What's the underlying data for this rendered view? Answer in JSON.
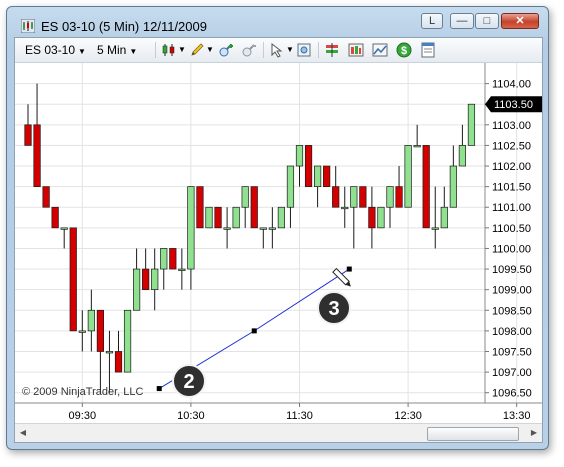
{
  "window": {
    "title": "ES 03-10 (5 Min)  12/11/2009",
    "buttons": {
      "link": "L",
      "minimize": "—",
      "maximize": "□",
      "close": "✕"
    }
  },
  "toolbar": {
    "instrument": "ES 03-10",
    "interval": "5 Min"
  },
  "chart": {
    "copyright": "© 2009 NinjaTrader, LLC",
    "price_axis": [
      "1104.00",
      "1103.50",
      "1103.00",
      "1102.50",
      "1102.00",
      "1101.50",
      "1101.00",
      "1100.50",
      "1100.00",
      "1099.50",
      "1099.00",
      "1098.50",
      "1098.00",
      "1097.50",
      "1097.00",
      "1096.50"
    ],
    "time_axis": [
      "09:30",
      "10:30",
      "11:30",
      "12:30",
      "13:30"
    ],
    "last_price": "1103.50",
    "markers": [
      "2",
      "3"
    ],
    "colors": {
      "up": "#8fe08f",
      "down": "#d40000",
      "line": "#1a2fd6",
      "grid": "#e3e3e3"
    }
  },
  "chart_data": {
    "type": "candlestick",
    "x_unit": "5-minute bars",
    "ylim": [
      1096.25,
      1104.5
    ],
    "candles": [
      [
        1103.0,
        1103.5,
        1102.5,
        1102.5
      ],
      [
        1103.0,
        1104.0,
        1101.5,
        1101.5
      ],
      [
        1101.5,
        1101.5,
        1101.0,
        1101.0
      ],
      [
        1101.0,
        1101.0,
        1100.5,
        1100.5
      ],
      [
        1100.5,
        1100.5,
        1100.0,
        1100.5
      ],
      [
        1100.5,
        1100.5,
        1098.0,
        1098.0
      ],
      [
        1098.0,
        1098.5,
        1097.5,
        1098.0
      ],
      [
        1098.0,
        1099.0,
        1097.5,
        1098.5
      ],
      [
        1098.5,
        1098.5,
        1096.5,
        1097.5
      ],
      [
        1097.5,
        1098.0,
        1096.5,
        1097.5
      ],
      [
        1097.5,
        1098.0,
        1097.0,
        1097.0
      ],
      [
        1097.0,
        1098.5,
        1097.0,
        1098.5
      ],
      [
        1098.5,
        1100.0,
        1098.5,
        1099.5
      ],
      [
        1099.5,
        1100.0,
        1099.0,
        1099.0
      ],
      [
        1099.0,
        1100.0,
        1098.5,
        1099.5
      ],
      [
        1099.5,
        1100.0,
        1099.0,
        1100.0
      ],
      [
        1100.0,
        1100.0,
        1099.5,
        1099.5
      ],
      [
        1099.5,
        1100.0,
        1099.0,
        1099.5
      ],
      [
        1099.5,
        1101.5,
        1099.0,
        1101.5
      ],
      [
        1101.5,
        1101.5,
        1100.5,
        1100.5
      ],
      [
        1100.5,
        1101.0,
        1100.5,
        1101.0
      ],
      [
        1101.0,
        1101.0,
        1100.5,
        1100.5
      ],
      [
        1100.5,
        1101.0,
        1100.0,
        1100.5
      ],
      [
        1100.5,
        1101.0,
        1100.5,
        1101.0
      ],
      [
        1101.0,
        1101.5,
        1100.5,
        1101.5
      ],
      [
        1101.5,
        1101.5,
        1100.5,
        1100.5
      ],
      [
        1100.5,
        1100.5,
        1100.0,
        1100.5
      ],
      [
        1100.5,
        1101.0,
        1100.0,
        1100.5
      ],
      [
        1100.5,
        1101.0,
        1100.5,
        1101.0
      ],
      [
        1101.0,
        1102.0,
        1100.5,
        1102.0
      ],
      [
        1102.0,
        1102.5,
        1101.5,
        1102.5
      ],
      [
        1102.5,
        1102.5,
        1101.5,
        1101.5
      ],
      [
        1101.5,
        1102.0,
        1101.0,
        1102.0
      ],
      [
        1102.0,
        1102.0,
        1101.5,
        1101.5
      ],
      [
        1101.5,
        1102.0,
        1101.0,
        1101.0
      ],
      [
        1101.0,
        1101.5,
        1100.5,
        1101.0
      ],
      [
        1101.0,
        1101.5,
        1100.0,
        1101.5
      ],
      [
        1101.5,
        1101.5,
        1101.0,
        1101.0
      ],
      [
        1101.0,
        1101.5,
        1100.0,
        1100.5
      ],
      [
        1100.5,
        1101.0,
        1100.5,
        1101.0
      ],
      [
        1101.0,
        1101.5,
        1100.5,
        1101.5
      ],
      [
        1101.5,
        1102.0,
        1101.0,
        1101.0
      ],
      [
        1101.0,
        1102.5,
        1101.0,
        1102.5
      ],
      [
        1102.5,
        1103.0,
        1102.5,
        1102.5
      ],
      [
        1102.5,
        1102.5,
        1100.5,
        1100.5
      ],
      [
        1100.5,
        1101.5,
        1100.0,
        1100.5
      ],
      [
        1100.5,
        1101.5,
        1100.5,
        1101.0
      ],
      [
        1101.0,
        1102.5,
        1101.0,
        1102.0
      ],
      [
        1102.0,
        1103.0,
        1102.0,
        1102.5
      ],
      [
        1102.5,
        1103.5,
        1102.5,
        1103.5
      ]
    ],
    "trendline": [
      {
        "bar": 14.5,
        "price": 1096.6
      },
      {
        "bar": 25,
        "price": 1098.0
      },
      {
        "bar": 35.5,
        "price": 1099.5
      }
    ]
  }
}
